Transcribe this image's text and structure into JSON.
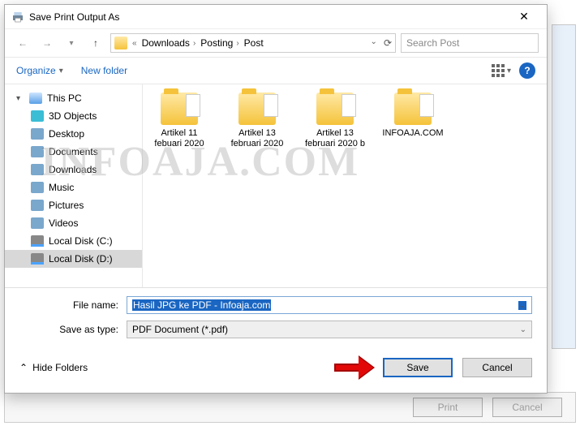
{
  "dialog": {
    "title": "Save Print Output As",
    "breadcrumb": [
      "Downloads",
      "Posting",
      "Post"
    ],
    "search_placeholder": "Search Post",
    "organize": "Organize",
    "new_folder": "New folder"
  },
  "tree": {
    "root": "This PC",
    "items": [
      {
        "label": "3D Objects",
        "ic": "obj"
      },
      {
        "label": "Desktop",
        "ic": "desk"
      },
      {
        "label": "Documents",
        "ic": "doc"
      },
      {
        "label": "Downloads",
        "ic": "down"
      },
      {
        "label": "Music",
        "ic": "mus"
      },
      {
        "label": "Pictures",
        "ic": "pic"
      },
      {
        "label": "Videos",
        "ic": "vid"
      },
      {
        "label": "Local Disk (C:)",
        "ic": "disk"
      },
      {
        "label": "Local Disk (D:)",
        "ic": "disk",
        "sel": true
      }
    ]
  },
  "files": [
    {
      "name": "Artikel 11 febuari 2020"
    },
    {
      "name": "Artikel 13 februari 2020"
    },
    {
      "name": "Artikel 13 februari 2020 b"
    },
    {
      "name": "INFOAJA.COM"
    }
  ],
  "fields": {
    "filename_label": "File name:",
    "filename_value": "Hasil JPG ke PDF - Infoaja.com",
    "type_label": "Save as type:",
    "type_value": "PDF Document (*.pdf)"
  },
  "footer": {
    "hide": "Hide Folders",
    "save": "Save",
    "cancel": "Cancel"
  },
  "background": {
    "print": "Print",
    "cancel": "Cancel"
  },
  "watermark": "INFOAJA.COM"
}
